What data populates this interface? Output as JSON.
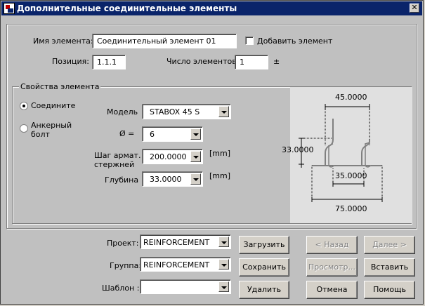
{
  "window": {
    "title": "Дополнительные соединительные элементы",
    "close_glyph": "✕"
  },
  "top": {
    "element_name_label": "Имя элемента:",
    "element_name_value": "Соединительный элемент 01",
    "add_element_label": "Добавить элемент",
    "position_label": "Позиция:",
    "position_value": "1.1.1",
    "count_label": "Число элементов:",
    "count_value": "1",
    "count_suffix": "±"
  },
  "props": {
    "group_title": "Свойства элемента",
    "radio_connector": "Соедините",
    "radio_anchor_line1": "Анкерный",
    "radio_anchor_line2": "болт",
    "model_label": "Модель",
    "model_value": "STABOX 45 S",
    "diam_label": "Ø  =",
    "diam_value": "6",
    "step_label_line1": "Шаг армат.",
    "step_label_line2": "стержней",
    "step_value": "200.0000",
    "step_unit": "[mm]",
    "depth_label": "Глубина",
    "depth_value": "33.0000",
    "depth_unit": "[mm]"
  },
  "drawing": {
    "dim_top": "45.0000",
    "dim_left": "33.0000",
    "dim_inner": "35.0000",
    "dim_bottom": "75.0000"
  },
  "bottom": {
    "project_label": "Проект:",
    "project_value": "REINFORCEMENT",
    "group_label": "Группа:",
    "group_value": "REINFORCEMENT",
    "template_label": "Шаблон :",
    "template_value": "",
    "load_button": "Загрузить",
    "save_button": "Сохранить",
    "delete_button": "Удалить",
    "back_button": "< Назад",
    "next_button": "Далее >",
    "preview_button": "Просмотр...",
    "insert_button": "Вставить",
    "cancel_button": "Отмена",
    "help_button": "Помощь"
  }
}
